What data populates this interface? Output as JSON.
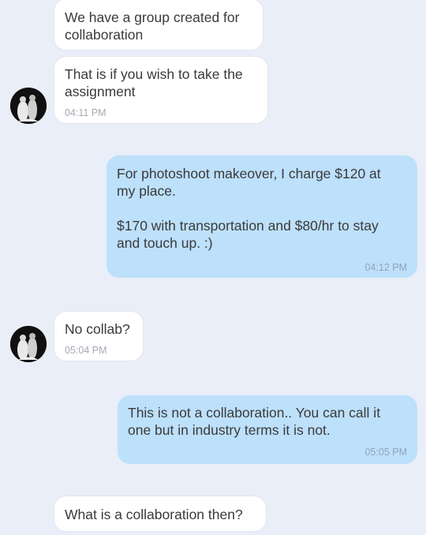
{
  "messages": [
    {
      "text": "We have a group created for\ncollaboration",
      "time": ""
    },
    {
      "text": "That is if you wish to take the\nassignment",
      "time": "04:11 PM"
    },
    {
      "text": "For photoshoot makeover, I charge $120 at\nmy place.\n\n$170 with transportation and $80/hr to stay\nand touch up. :)",
      "time": "04:12 PM"
    },
    {
      "text": "No collab?",
      "time": "05:04 PM"
    },
    {
      "text": "This is not a collaboration..  You can call it\none but in industry terms it is not.",
      "time": "05:05 PM"
    },
    {
      "text": "What is a collaboration then?",
      "time": ""
    }
  ],
  "avatar_icon": "contact-photo-icon"
}
